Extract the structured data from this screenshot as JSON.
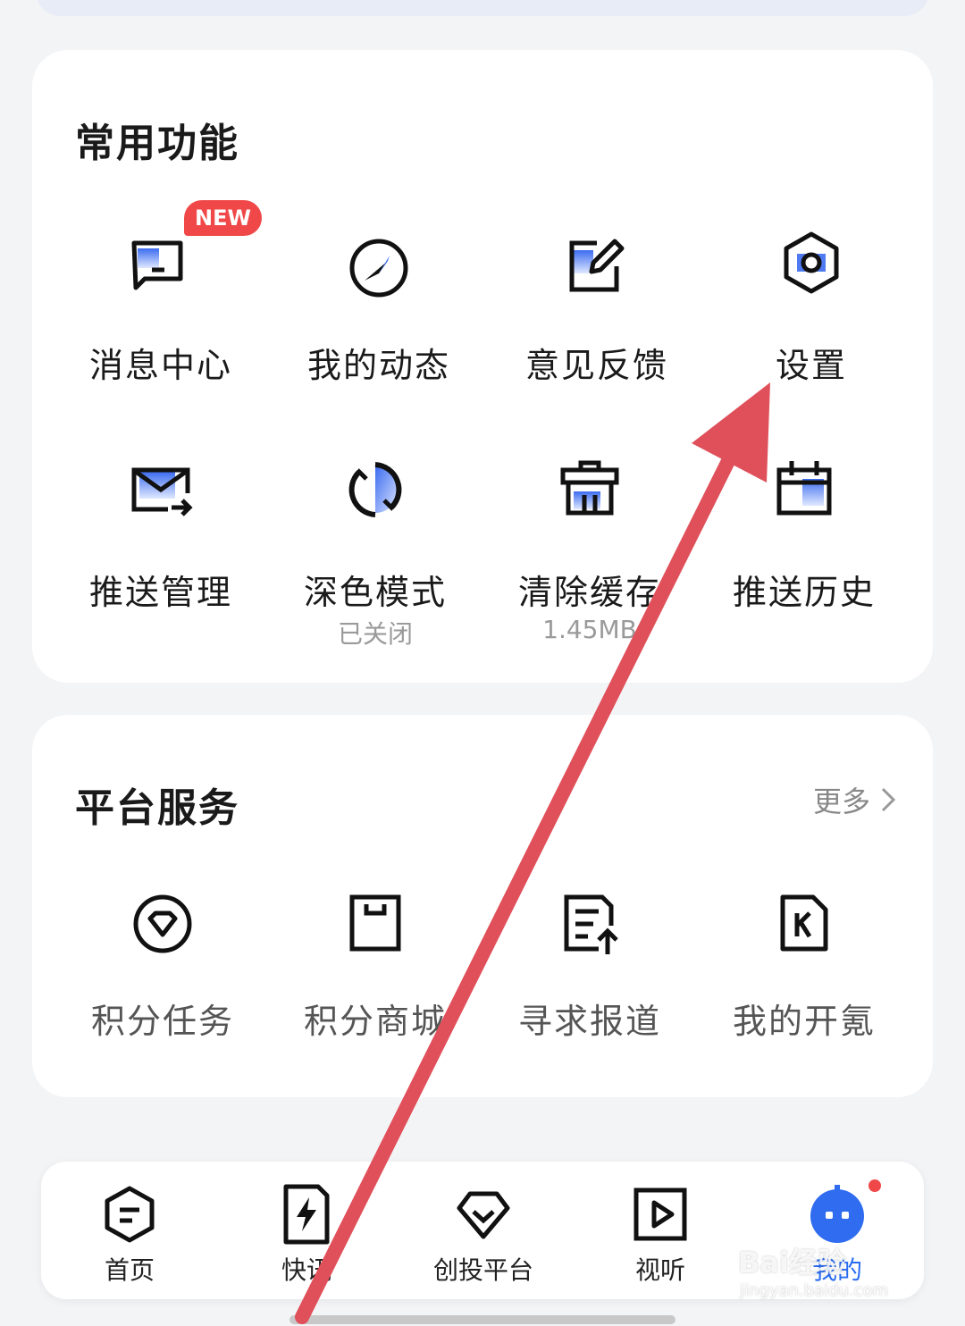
{
  "common_functions": {
    "title": "常用功能",
    "items": [
      {
        "label": "消息中心",
        "icon": "message-icon",
        "badge": "NEW"
      },
      {
        "label": "我的动态",
        "icon": "compass-icon"
      },
      {
        "label": "意见反馈",
        "icon": "edit-icon"
      },
      {
        "label": "设置",
        "icon": "settings-icon"
      },
      {
        "label": "推送管理",
        "icon": "mail-forward-icon"
      },
      {
        "label": "深色模式",
        "icon": "dark-mode-icon",
        "sub": "已关闭"
      },
      {
        "label": "清除缓存",
        "icon": "clear-cache-icon",
        "sub": "1.45MB"
      },
      {
        "label": "推送历史",
        "icon": "calendar-icon"
      }
    ]
  },
  "platform_services": {
    "title": "平台服务",
    "more_label": "更多",
    "items": [
      {
        "label": "积分任务",
        "icon": "diamond-icon"
      },
      {
        "label": "积分商城",
        "icon": "shopping-bag-icon"
      },
      {
        "label": "寻求报道",
        "icon": "report-upload-icon"
      },
      {
        "label": "我的开氪",
        "icon": "k-document-icon"
      }
    ]
  },
  "tabbar": {
    "tabs": [
      {
        "label": "首页",
        "icon": "home-hexagon-icon"
      },
      {
        "label": "快讯",
        "icon": "flash-icon"
      },
      {
        "label": "创投平台",
        "icon": "gem-icon"
      },
      {
        "label": "视听",
        "icon": "play-icon"
      },
      {
        "label": "我的",
        "icon": "robot-avatar-icon",
        "active": true
      }
    ]
  },
  "watermark": {
    "text": "Bai经验",
    "sub": "jingyan.baidu.com"
  },
  "colors": {
    "accent": "#2a6cf0",
    "badge": "#f04848",
    "arrow": "#e0505a"
  }
}
